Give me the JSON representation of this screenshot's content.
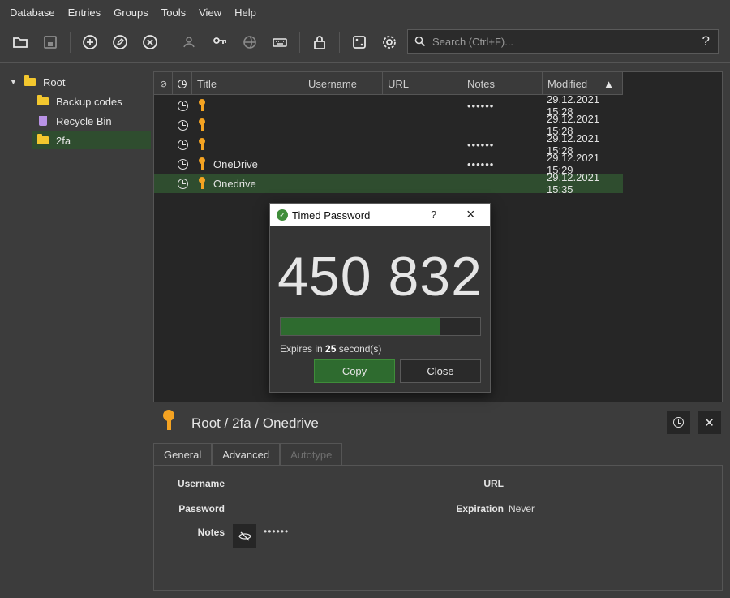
{
  "menu": [
    "Database",
    "Entries",
    "Groups",
    "Tools",
    "View",
    "Help"
  ],
  "search": {
    "placeholder": "Search (Ctrl+F)...",
    "help": "?"
  },
  "tree": {
    "root": "Root",
    "items": [
      "Backup codes",
      "Recycle Bin",
      "2fa"
    ],
    "selected": "2fa"
  },
  "table": {
    "columns": [
      "Title",
      "Username",
      "URL",
      "Notes",
      "Modified"
    ],
    "rows": [
      {
        "title": "",
        "notes": "••••••",
        "modified": "29.12.2021 15:28"
      },
      {
        "title": "",
        "notes": "",
        "modified": "29.12.2021 15:28"
      },
      {
        "title": "",
        "notes": "••••••",
        "modified": "29.12.2021 15:28"
      },
      {
        "title": "OneDrive",
        "notes": "••••••",
        "modified": "29.12.2021 15:29"
      },
      {
        "title": "Onedrive",
        "notes": "",
        "modified": "29.12.2021 15:35"
      }
    ]
  },
  "dialog": {
    "title": "Timed Password",
    "help": "?",
    "code": "450 832",
    "progress_fraction": 0.8,
    "expires_prefix": "Expires in ",
    "expires_seconds": "25",
    "expires_suffix": " second(s)",
    "copy_label": "Copy",
    "close_label": "Close"
  },
  "details": {
    "path": "Root / 2fa / Onedrive",
    "tabs": [
      "General",
      "Advanced",
      "Autotype"
    ],
    "username_label": "Username",
    "password_label": "Password",
    "notes_label": "Notes",
    "notes_value": "••••••",
    "url_label": "URL",
    "expiration_label": "Expiration",
    "expiration_value": "Never"
  },
  "colors": {
    "accent": "#2e6b2f",
    "key": "#f4a322",
    "folder": "#f3c72e"
  }
}
